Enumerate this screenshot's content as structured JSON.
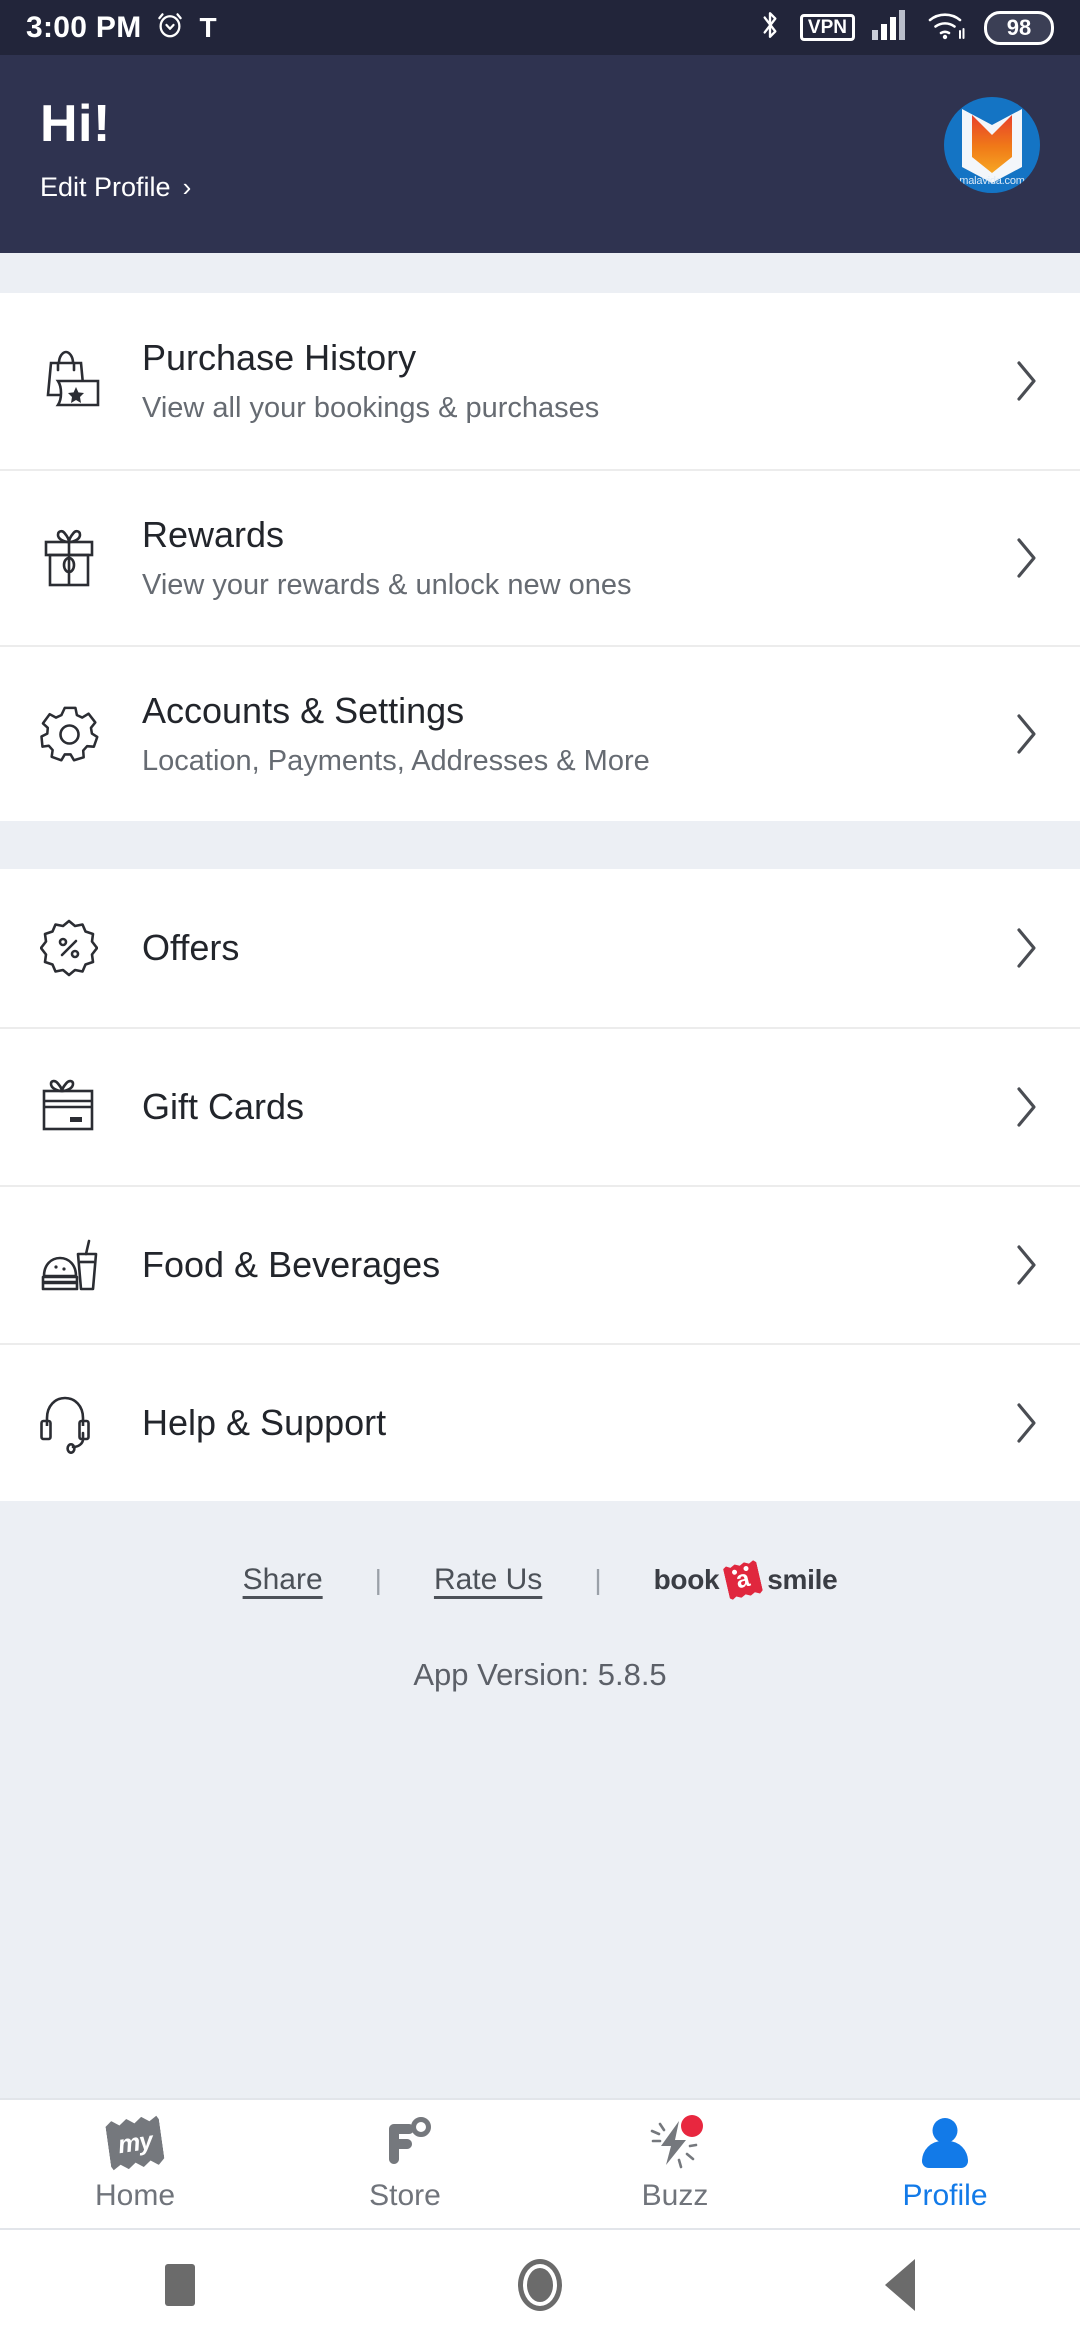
{
  "status_bar": {
    "time": "3:00 PM",
    "alarm_icon": "alarm-icon",
    "text_glyph": "T",
    "bluetooth_icon": "bluetooth-icon",
    "vpn_label": "VPN",
    "signal_icon": "cellular-signal-icon",
    "wifi_icon": "wifi-icon",
    "battery_level": "98"
  },
  "header": {
    "greeting": "Hi!",
    "edit_profile": "Edit Profile",
    "chevron": "›",
    "avatar_caption": "malavida.com",
    "background_color": "#2f3350"
  },
  "menu_groups": [
    {
      "items": [
        {
          "icon": "shopping-bag-ticket-icon",
          "title": "Purchase History",
          "subtitle": "View all your bookings & purchases"
        },
        {
          "icon": "gift-box-icon",
          "title": "Rewards",
          "subtitle": "View your rewards & unlock new ones"
        },
        {
          "icon": "gear-icon",
          "title": "Accounts & Settings",
          "subtitle": "Location, Payments, Addresses & More"
        }
      ]
    },
    {
      "items": [
        {
          "icon": "discount-badge-icon",
          "title": "Offers",
          "subtitle": ""
        },
        {
          "icon": "gift-card-icon",
          "title": "Gift Cards",
          "subtitle": ""
        },
        {
          "icon": "food-beverage-icon",
          "title": "Food & Beverages",
          "subtitle": ""
        },
        {
          "icon": "headset-support-icon",
          "title": "Help & Support",
          "subtitle": ""
        }
      ]
    }
  ],
  "footer": {
    "share_label": "Share",
    "separator": "|",
    "rate_us_label": "Rate Us",
    "brand": {
      "word1": "book",
      "letter": "a",
      "word2": "smile",
      "accent_color": "#e0273e"
    },
    "app_version": "App Version: 5.8.5"
  },
  "bottom_nav": {
    "active_color": "#127ae8",
    "inactive_color": "#70747b",
    "items": [
      {
        "icon": "my-ticket-icon",
        "label": "Home",
        "active": false,
        "badge": false
      },
      {
        "icon": "fnb-store-icon",
        "label": "Store",
        "active": false,
        "badge": false
      },
      {
        "icon": "buzz-lightning-icon",
        "label": "Buzz",
        "active": false,
        "badge": true
      },
      {
        "icon": "person-profile-icon",
        "label": "Profile",
        "active": true,
        "badge": false
      }
    ]
  },
  "android_nav": {
    "recents": "recents-square-icon",
    "home": "home-circle-icon",
    "back": "back-triangle-icon"
  }
}
